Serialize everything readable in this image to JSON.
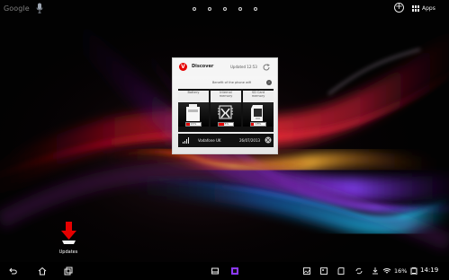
{
  "top_bar": {
    "search_text": "Google",
    "icons": {
      "mic": "microphone-icon",
      "add_widget": "plus-circle-icon",
      "apps": "apps-grid-icon"
    },
    "page_dots": [
      1,
      2,
      3,
      4,
      5
    ],
    "apps_label": "Apps"
  },
  "widget": {
    "title": "Discover",
    "updated": "Updated 12:53",
    "benefit_text": "Benefit of the phone wifi",
    "metrics": [
      {
        "label_line1": "Battery",
        "label_line2": "",
        "usage": "21%",
        "icon": "battery-icon"
      },
      {
        "label_line1": "Internal",
        "label_line2": "memory",
        "usage": "35%",
        "icon": "internal-memory-icon"
      },
      {
        "label_line1": "SD Card",
        "label_line2": "memory",
        "usage": "18%",
        "icon": "sd-card-icon"
      }
    ],
    "operator": "Vodafone UK",
    "date": "26/07/2013"
  },
  "shortcut": {
    "label": "Updates",
    "icon": "download-arrow-icon"
  },
  "nav": {
    "battery_percent": "16%",
    "time": "14:19"
  },
  "colors": {
    "accent": "#e60000",
    "wallpaper_red": "#c4182f",
    "wallpaper_purple": "#7e34d6",
    "wallpaper_blue": "#2f6bd8",
    "wallpaper_orange": "#ff7a18"
  }
}
